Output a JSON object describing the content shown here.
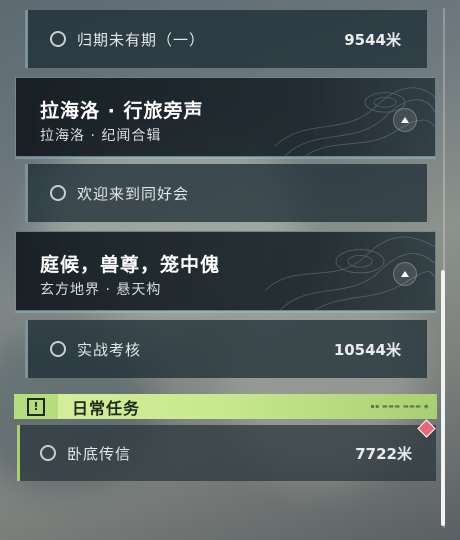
{
  "quests": {
    "rows": [
      {
        "name": "归期未有期（一）",
        "distance": "9544米"
      }
    ],
    "chapter1": {
      "title": "拉海洛 · 行旅旁声",
      "subtitle": "拉海洛 · 纪闻合辑",
      "expand_icon": "chevron-up-icon"
    },
    "row2": {
      "name": "欢迎来到同好会"
    },
    "chapter2": {
      "title": "庭候，兽尊，笼中傀",
      "subtitle": "玄方地界 · 悬天构",
      "expand_icon": "chevron-up-icon"
    },
    "row3": {
      "name": "实战考核",
      "distance": "10544米"
    }
  },
  "daily": {
    "header_label": "日常任务",
    "badge_icon": "exclamation-icon",
    "row": {
      "name": "卧底传信",
      "distance": "7722米"
    },
    "marker_icon": "diamond-marker-icon",
    "accent_color": "#c7e88d"
  },
  "colors": {
    "panel_bg": "#18282f",
    "card_border": "#aacdd7",
    "marker": "#e6687a"
  }
}
